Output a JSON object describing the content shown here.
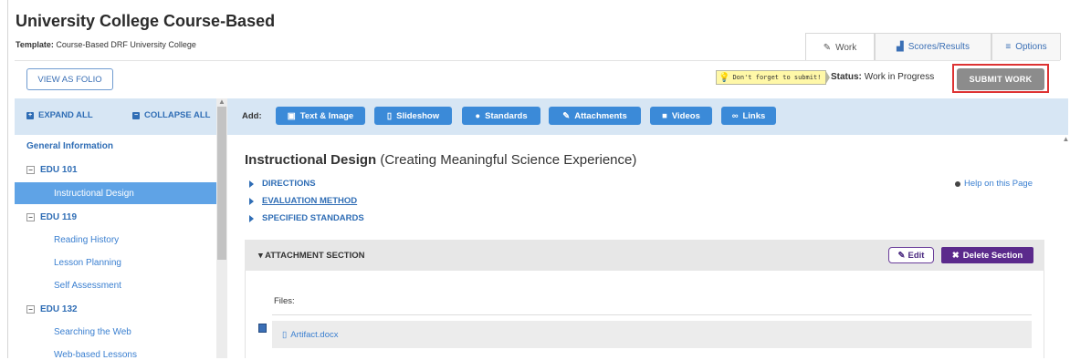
{
  "header": {
    "title": "University College Course-Based",
    "template_label": "Template:",
    "template_value": "Course-Based DRF University College"
  },
  "tabs": [
    {
      "label": "Work",
      "icon": "edit-icon"
    },
    {
      "label": "Scores/Results",
      "icon": "chart-icon"
    },
    {
      "label": "Options",
      "icon": "menu-icon"
    }
  ],
  "actions": {
    "view_as_folio": "VIEW AS FOLIO",
    "reminder": "Don't forget to submit!",
    "status_label": "Status:",
    "status_value": "Work in Progress",
    "submit": "SUBMIT WORK"
  },
  "sidebar": {
    "expand_all": "EXPAND ALL",
    "collapse_all": "COLLAPSE ALL",
    "section": "General Information",
    "groups": [
      {
        "label": "EDU 101",
        "items": [
          "Instructional Design"
        ]
      },
      {
        "label": "EDU 119",
        "items": [
          "Reading History",
          "Lesson Planning",
          "Self Assessment"
        ]
      },
      {
        "label": "EDU 132",
        "items": [
          "Searching the Web",
          "Web-based Lessons"
        ]
      }
    ],
    "active_item": "Instructional Design"
  },
  "toolbar": {
    "add_label": "Add:",
    "buttons": [
      "Text & Image",
      "Slideshow",
      "Standards",
      "Attachments",
      "Videos",
      "Links"
    ]
  },
  "main": {
    "title_bold": "Instructional Design",
    "title_rest": "(Creating Meaningful Science Experience)",
    "collapsibles": [
      "DIRECTIONS",
      "EVALUATION METHOD",
      "SPECIFIED STANDARDS"
    ],
    "help": "Help on this Page",
    "section_title": "ATTACHMENT SECTION",
    "edit": "Edit",
    "delete": "Delete Section",
    "files_label": "Files:",
    "file_name": "Artifact.docx"
  },
  "colors": {
    "accent": "#3b8ad8",
    "active_nav": "#5fa3e6",
    "delete": "#5b2a8c",
    "submit_border": "#dd3333"
  }
}
